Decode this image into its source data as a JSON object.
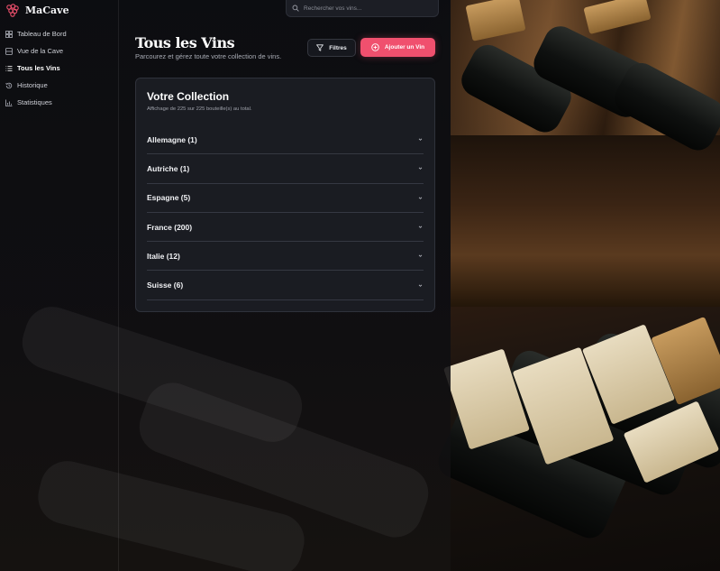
{
  "app": {
    "name": "MaCave",
    "accent_color": "#f0506e"
  },
  "sidebar": {
    "items": [
      {
        "label": "Tableau de Bord",
        "icon": "dashboard-grid-icon",
        "active": false
      },
      {
        "label": "Vue de la Cave",
        "icon": "cellar-view-icon",
        "active": false
      },
      {
        "label": "Tous les Vins",
        "icon": "list-icon",
        "active": true
      },
      {
        "label": "Historique",
        "icon": "history-icon",
        "active": false
      },
      {
        "label": "Statistiques",
        "icon": "chart-icon",
        "active": false
      }
    ]
  },
  "header": {
    "search_placeholder": "Rechercher vos vins..."
  },
  "page": {
    "title": "Tous les Vins",
    "subtitle": "Parcourez et gérez toute votre collection de vins.",
    "filter_label": "Filtres",
    "add_label": "Ajouter un Vin"
  },
  "collection": {
    "title": "Votre Collection",
    "summary": "Affichage de 225 sur 225 bouteille(s) au total.",
    "countries": [
      {
        "label": "Allemagne (1)"
      },
      {
        "label": "Autriche (1)"
      },
      {
        "label": "Espagne (5)"
      },
      {
        "label": "France (200)"
      },
      {
        "label": "Italie (12)"
      },
      {
        "label": "Suisse (6)"
      }
    ]
  }
}
